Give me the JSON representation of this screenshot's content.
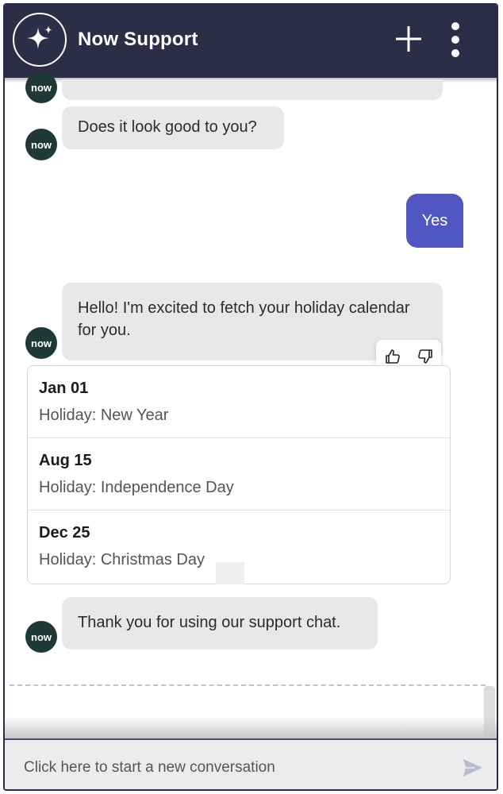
{
  "header": {
    "title": "Now Support"
  },
  "messages": {
    "avatar_label": "now",
    "bot_question": "Does it look good to you?",
    "user_reply": "Yes",
    "bot_intro": "Hello! I'm excited to fetch your holiday calendar for you.",
    "bot_thanks": "Thank you for using our support chat."
  },
  "holidays": [
    {
      "date": "Jan 01",
      "desc": "Holiday: New Year"
    },
    {
      "date": "Aug 15",
      "desc": "Holiday: Independence Day"
    },
    {
      "date": "Dec 25",
      "desc": "Holiday: Christmas Day"
    }
  ],
  "composer": {
    "placeholder": "Click here to start a new conversation"
  },
  "colors": {
    "header_bg": "#2d2d48",
    "user_bubble": "#5057c2",
    "bot_bubble": "#e8e8ea",
    "avatar_bg": "#1f3a36"
  }
}
